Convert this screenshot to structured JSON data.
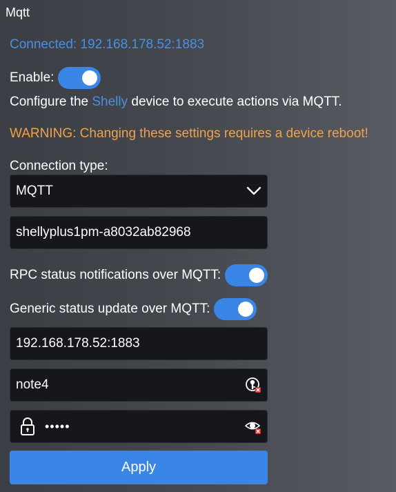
{
  "header": {
    "title": "Mqtt"
  },
  "status": {
    "text": "Connected: 192.168.178.52:1883"
  },
  "enable": {
    "label": "Enable:",
    "on": true
  },
  "description": {
    "prefix": "Configure the ",
    "link": "Shelly",
    "suffix": " device to execute actions via MQTT."
  },
  "warning": "WARNING: Changing these settings requires a device reboot!",
  "connection_type": {
    "label": "Connection type:",
    "selected": "MQTT"
  },
  "client_id": {
    "value": "shellyplus1pm-a8032ab82968"
  },
  "rpc_notifications": {
    "label": "RPC status notifications over MQTT:",
    "on": true
  },
  "generic_status": {
    "label": "Generic status update over MQTT:",
    "on": true
  },
  "server": {
    "value": "192.168.178.52:1883"
  },
  "user": {
    "value": "note4"
  },
  "password": {
    "value": "•••••"
  },
  "apply": {
    "label": "Apply"
  },
  "colors": {
    "accent": "#3a86e6",
    "link": "#4a90e2",
    "warning": "#f0a24a",
    "field_bg": "#16171a"
  },
  "icons": {
    "select": "chevron-down-icon",
    "user_clear": "key-clear-icon",
    "password_lock": "lock-icon",
    "password_toggle": "eye-clear-icon"
  }
}
